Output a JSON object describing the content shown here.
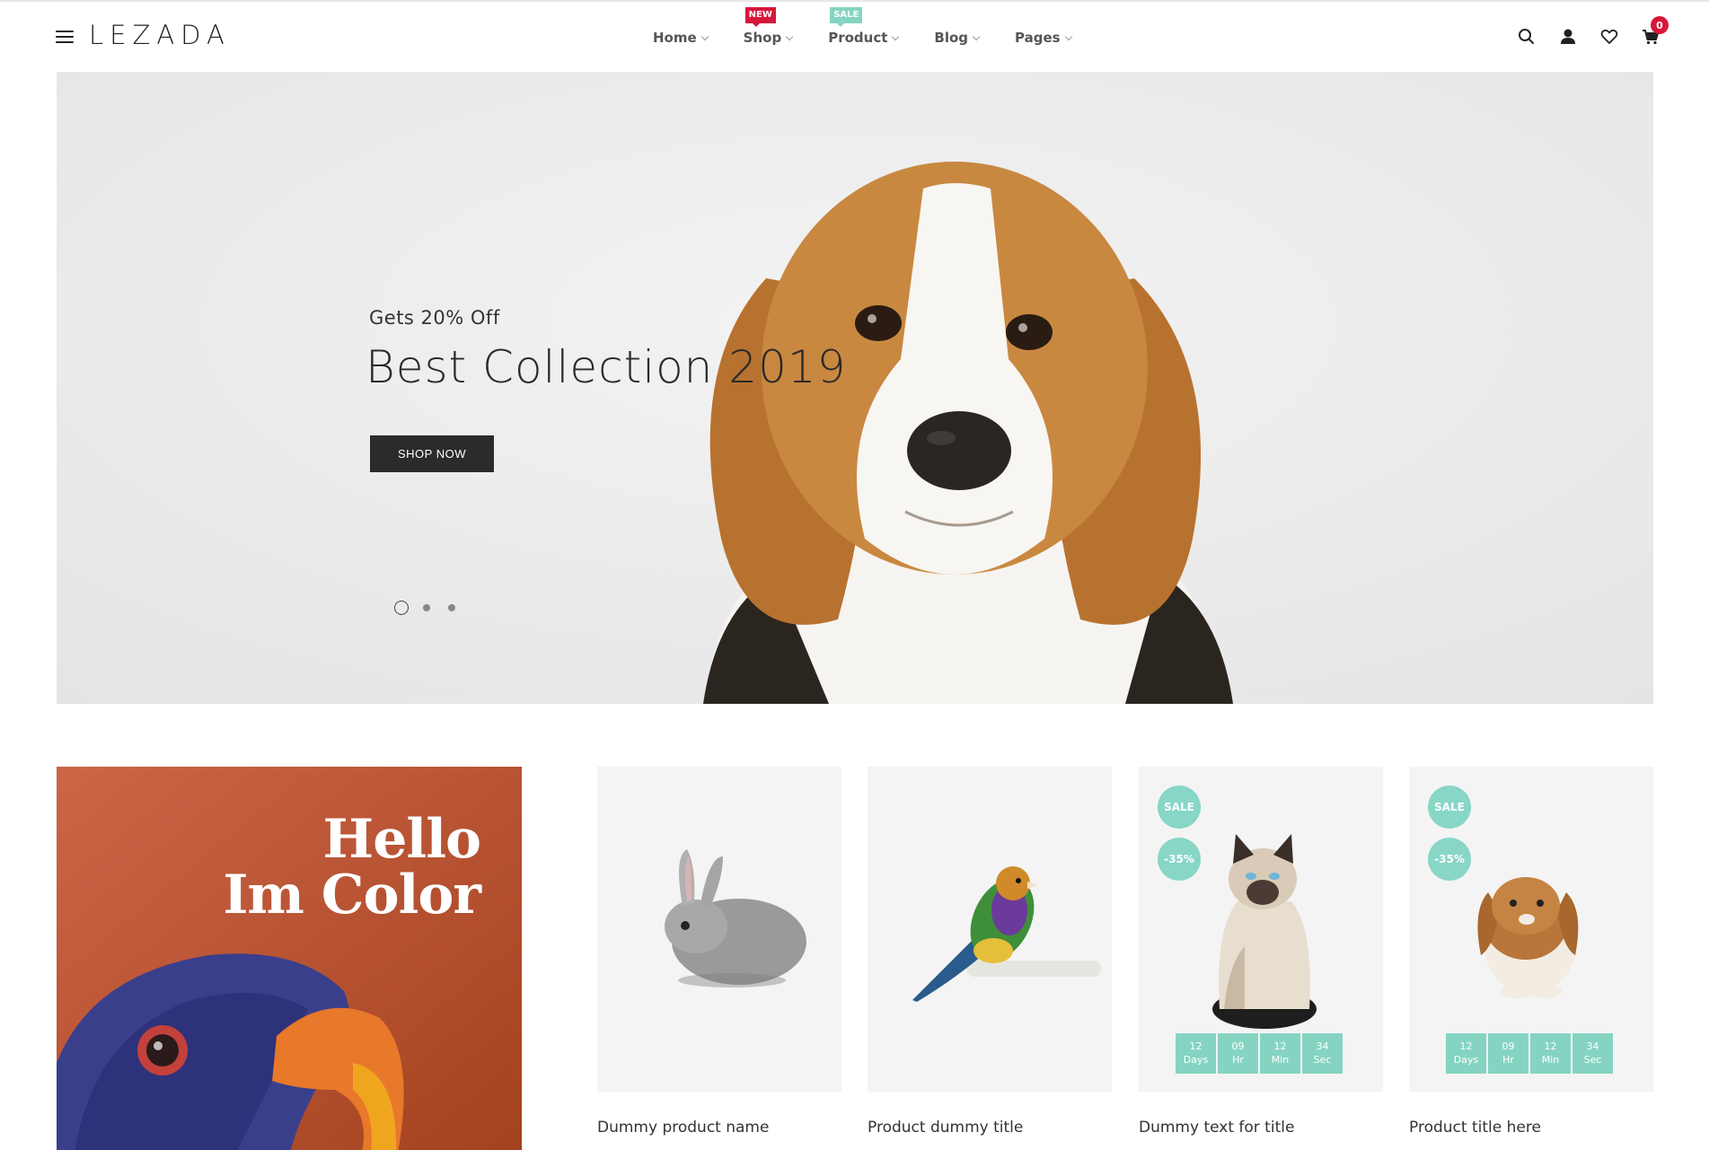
{
  "header": {
    "logo": "LEZADA",
    "nav": [
      {
        "label": "Home",
        "badge": ""
      },
      {
        "label": "Shop",
        "badge": "NEW"
      },
      {
        "label": "Product",
        "badge": "SALE"
      },
      {
        "label": "Blog",
        "badge": ""
      },
      {
        "label": "Pages",
        "badge": ""
      }
    ],
    "cart_count": "0",
    "icons": [
      "search-icon",
      "user-icon",
      "heart-icon",
      "cart-icon"
    ]
  },
  "hero": {
    "subtitle": "Gets 20% Off",
    "title": "Best Collection 2019",
    "button": "SHOP NOW",
    "slides": 3,
    "active_slide": 1
  },
  "promo": {
    "line1": "Hello",
    "line2": "Im Color"
  },
  "products": [
    {
      "title": "Dummy product name",
      "sale": "",
      "discount": "",
      "countdown": null
    },
    {
      "title": "Product dummy title",
      "sale": "",
      "discount": "",
      "countdown": null
    },
    {
      "title": "Dummy text for title",
      "sale": "SALE",
      "discount": "-35%",
      "countdown": [
        {
          "value": "12",
          "unit": "Days"
        },
        {
          "value": "09",
          "unit": "Hr"
        },
        {
          "value": "12",
          "unit": "Min"
        },
        {
          "value": "34",
          "unit": "Sec"
        }
      ]
    },
    {
      "title": "Product title here",
      "sale": "SALE",
      "discount": "-35%",
      "countdown": [
        {
          "value": "12",
          "unit": "Days"
        },
        {
          "value": "09",
          "unit": "Hr"
        },
        {
          "value": "12",
          "unit": "Min"
        },
        {
          "value": "34",
          "unit": "Sec"
        }
      ]
    }
  ],
  "colors": {
    "accent_red": "#d6173a",
    "accent_teal": "#85d4c2",
    "button_dark": "#2b2b2b"
  }
}
